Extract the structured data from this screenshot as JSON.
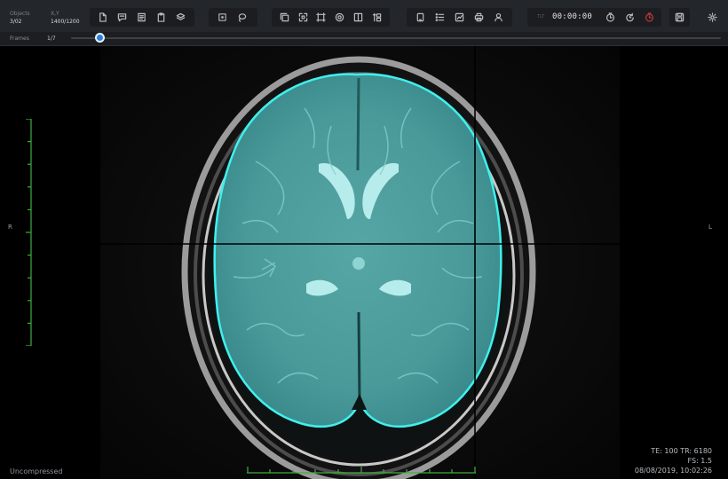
{
  "toolbar": {
    "objects_label": "Objects",
    "objects_value": "3/02",
    "xy_label": "X,Y",
    "xy_value": "1400/1200",
    "timer_label": "TLT",
    "timer_value": "00:00:00",
    "group1_icons": [
      "new-file-icon",
      "comment-icon",
      "list-doc-icon",
      "clipboard-icon",
      "layers-icon"
    ],
    "group2_icons": [
      "select-box-icon",
      "lasso-icon"
    ],
    "group3_icons": [
      "copy-icon",
      "expand-icon",
      "crop-icon",
      "target-icon",
      "split-icon",
      "transform-icon"
    ],
    "group4_icons": [
      "tablet-icon",
      "checklist-icon",
      "chart-icon",
      "print-icon",
      "user-icon"
    ],
    "group5_icons": [
      "clock-icon",
      "refresh-timer-icon",
      "record-timer-icon"
    ],
    "accent_color": "#2a82d8",
    "record_color": "#c03b3b"
  },
  "frames": {
    "label": "Frames",
    "count": "1/7",
    "progress": 0.04
  },
  "viewer": {
    "orientation_left": "R",
    "orientation_right": "L",
    "compression": "Uncompressed",
    "meta_line1": "TE: 100 TR: 6180",
    "meta_line2": "FS: 1.5",
    "meta_line3": "08/08/2019, 10:02:26",
    "segmentation_color": "#3ecfcf",
    "ruler_color": "#3fae3f"
  }
}
